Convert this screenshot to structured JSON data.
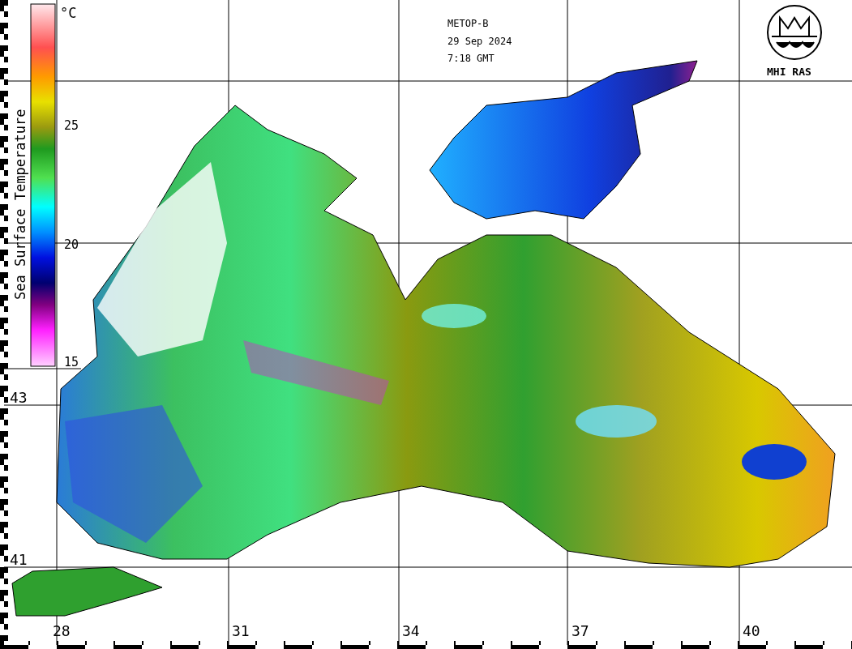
{
  "header": {
    "satellite": "METOP-B",
    "date": "29 Sep 2024",
    "time": "7:18 GMT"
  },
  "logo": {
    "text": "MHI RAS"
  },
  "colorbar": {
    "title": "Sea Surface Temperature",
    "unit": "°C",
    "ticks": [
      "25",
      "20",
      "15"
    ]
  },
  "latitude_labels": [
    "43",
    "41"
  ],
  "longitude_labels": [
    "28",
    "31",
    "34",
    "37",
    "40"
  ]
}
